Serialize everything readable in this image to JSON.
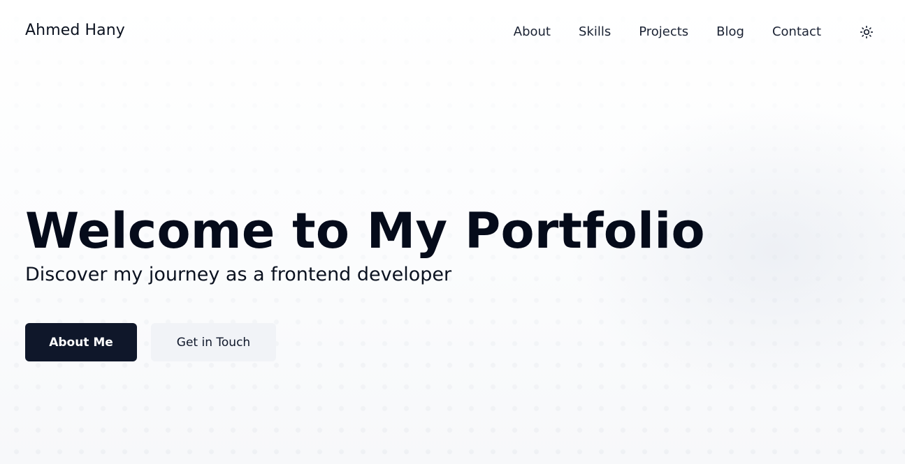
{
  "header": {
    "brand": "Ahmed Hany",
    "nav": [
      {
        "label": "About"
      },
      {
        "label": "Skills"
      },
      {
        "label": "Projects"
      },
      {
        "label": "Blog"
      },
      {
        "label": "Contact"
      }
    ],
    "theme_toggle_icon": "sun-icon"
  },
  "hero": {
    "title": "Welcome to My Portfolio",
    "subtitle": "Discover my journey as a frontend developer",
    "primary_button": "About Me",
    "secondary_button": "Get in Touch"
  },
  "colors": {
    "primary": "#0f172a",
    "secondary_bg": "#f1f3f7",
    "text": "#0b1220",
    "background": "#ffffff"
  }
}
